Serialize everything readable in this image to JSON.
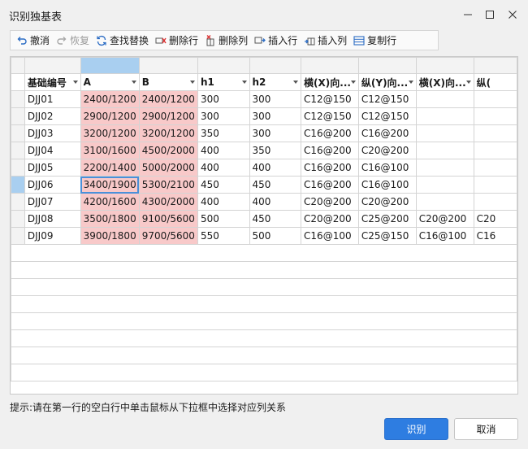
{
  "window": {
    "title": "识别独基表"
  },
  "toolbar": {
    "items": [
      {
        "label": "撤消",
        "icon": "undo-icon",
        "enabled": true
      },
      {
        "label": "恢复",
        "icon": "redo-icon",
        "enabled": false
      },
      {
        "label": "查找替换",
        "icon": "find-replace-icon",
        "enabled": true
      },
      {
        "label": "删除行",
        "icon": "delete-row-icon",
        "enabled": true
      },
      {
        "label": "删除列",
        "icon": "delete-column-icon",
        "enabled": true
      },
      {
        "label": "插入行",
        "icon": "insert-row-icon",
        "enabled": true
      },
      {
        "label": "插入列",
        "icon": "insert-column-icon",
        "enabled": true
      },
      {
        "label": "复制行",
        "icon": "copy-row-icon",
        "enabled": true
      }
    ]
  },
  "table": {
    "columns": [
      "基础编号",
      "A",
      "B",
      "h1",
      "h2",
      "横(X)向...",
      "纵(Y)向...",
      "横(X)向...",
      "纵("
    ],
    "rows": [
      [
        "DJJ01",
        "2400/1200",
        "2400/1200",
        "300",
        "300",
        "C12@150",
        "C12@150",
        "",
        ""
      ],
      [
        "DJJ02",
        "2900/1200",
        "2900/1200",
        "300",
        "300",
        "C12@150",
        "C12@150",
        "",
        ""
      ],
      [
        "DJJ03",
        "3200/1200",
        "3200/1200",
        "350",
        "300",
        "C16@200",
        "C16@200",
        "",
        ""
      ],
      [
        "DJJ04",
        "3100/1600",
        "4500/2000",
        "400",
        "350",
        "C16@200",
        "C20@200",
        "",
        ""
      ],
      [
        "DJJ05",
        "2200/1400",
        "5000/2000",
        "400",
        "400",
        "C16@200",
        "C16@100",
        "",
        ""
      ],
      [
        "DJJ06",
        "3400/1900",
        "5300/2100",
        "450",
        "450",
        "C16@200",
        "C16@100",
        "",
        ""
      ],
      [
        "DJJ07",
        "4200/1600",
        "4300/2000",
        "400",
        "400",
        "C20@200",
        "C20@200",
        "",
        ""
      ],
      [
        "DJJ08",
        "3500/1800",
        "9100/5600",
        "500",
        "450",
        "C20@200",
        "C25@200",
        "C20@200",
        "C20"
      ],
      [
        "DJJ09",
        "3900/1800",
        "9700/5600",
        "550",
        "500",
        "C16@100",
        "C25@150",
        "C16@100",
        "C16"
      ]
    ],
    "selected_row_index": 5,
    "selected_map_column_index": 1
  },
  "hint": "提示:请在第一行的空白行中单击鼠标从下拉框中选择对应列关系",
  "buttons": {
    "ok": "识别",
    "cancel": "取消"
  },
  "colors": {
    "accent": "#2e7de1",
    "highlight": "#f8c9c9",
    "selection": "#a9cff0"
  }
}
